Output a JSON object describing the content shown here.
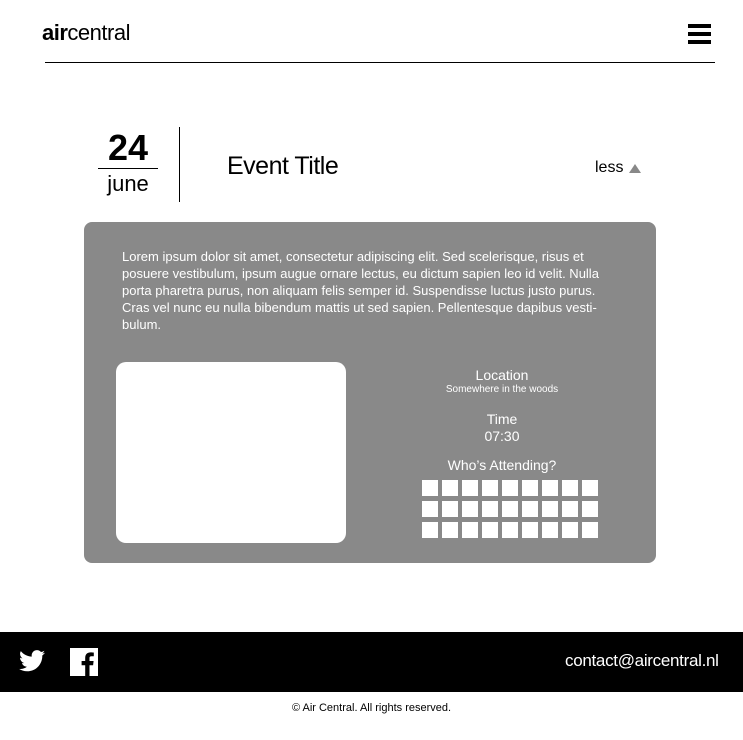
{
  "header": {
    "logo_bold": "air",
    "logo_light": "central",
    "menu_icon": "hamburger-menu-icon"
  },
  "event": {
    "day": "24",
    "month": "june",
    "title": "Event Title",
    "toggle_label": "less",
    "toggle_icon": "triangle-up-icon",
    "description": "Lorem ipsum dolor sit amet, consectetur adipiscing elit. Sed scelerisque, risus et posuere vestibulum, ipsum augue ornare lectus, eu dictum sapien leo id velit. Nulla porta pharetra purus, non aliquam felis semper id. Suspendisse luctus justo purus. Cras vel nunc eu nulla bibendum mattis ut sed sapien. Pellentesque dapibus vesti-bulum.",
    "location_label": "Location",
    "location_value": "Somewhere in the woods",
    "time_label": "Time",
    "time_value": "07:30",
    "attending_label": "Who’s Attending?",
    "attendee_count": 27
  },
  "footer": {
    "twitter_icon": "twitter-icon",
    "facebook_icon": "facebook-icon",
    "contact": "contact@aircentral.nl",
    "copyright": "©  Air Central. All rights reserved."
  },
  "colors": {
    "panel": "#898989",
    "footer": "#000000",
    "text_light": "#ffffff"
  }
}
